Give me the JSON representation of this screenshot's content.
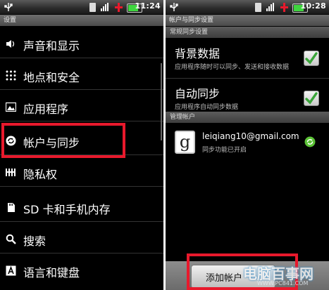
{
  "left": {
    "status_time": "11:24",
    "title": "设置",
    "items": [
      {
        "label": "声音和显示",
        "icon": "speaker-icon"
      },
      {
        "label": "地点和安全",
        "icon": "location-grid-icon"
      },
      {
        "label": "应用程序",
        "icon": "image-icon"
      },
      {
        "label": "帐户与同步",
        "icon": "sync-circle-icon"
      },
      {
        "label": "隐私权",
        "icon": "privacy-bars-icon"
      },
      {
        "label": "SD 卡和手机内存",
        "icon": "sdcard-icon"
      },
      {
        "label": "搜索",
        "icon": "magnifier-icon"
      },
      {
        "label": "语言和键盘",
        "icon": "keyboard-a-icon"
      }
    ]
  },
  "right": {
    "status_time": "10:28",
    "title": "帐户与同步设置",
    "section_general": "常规同步设置",
    "settings": [
      {
        "title": "背景数据",
        "desc": "应用程序随时可以同步、发送和接收数据",
        "checked": true
      },
      {
        "title": "自动同步",
        "desc": "应用程序自动同步数据",
        "checked": true
      }
    ],
    "section_manage": "管理帐户",
    "account": {
      "logo_letter": "g",
      "email": "leiqiang10@gmail.com",
      "status": "同步功能已开启"
    },
    "add_account_label": "添加帐户"
  },
  "watermark": {
    "title": "电脑百事网",
    "url": "WWW.PC841.COM"
  },
  "colors": {
    "highlight_red": "#e8192c",
    "check_green": "#3aa53a",
    "background": "#000000"
  }
}
